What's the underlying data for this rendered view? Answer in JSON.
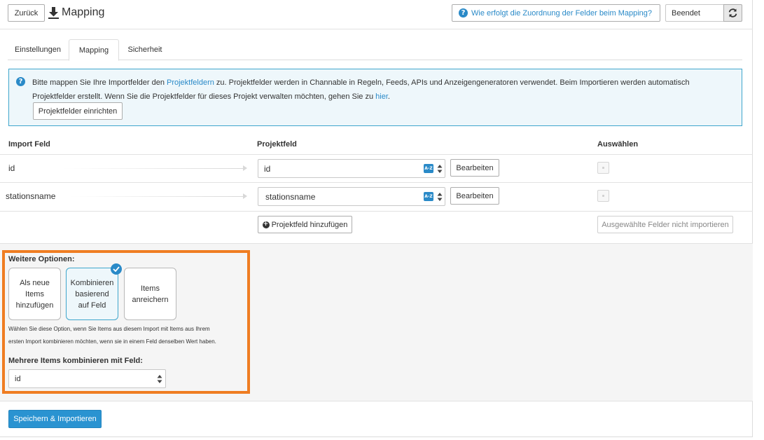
{
  "header": {
    "back_label": "Zurück",
    "title": "Mapping",
    "help_link": "Wie erfolgt die Zuordnung der Felder beim Mapping?",
    "status": "Beendet"
  },
  "tabs": [
    {
      "label": "Einstellungen"
    },
    {
      "label": "Mapping"
    },
    {
      "label": "Sicherheit"
    }
  ],
  "info": {
    "text_1": "Bitte mappen Sie Ihre Importfelder den ",
    "link_1": "Projektfeldern",
    "text_2": " zu. Projektfelder werden in Channable in Regeln, Feeds, APIs und Anzeigengeneratoren verwendet. Beim Importieren werden automatisch Projektfelder erstellt. Wenn Sie die Projektfelder für dieses Projekt verwalten möchten, gehen Sie zu ",
    "link_2": "hier",
    "text_3": ".",
    "setup_button": "Projektfelder einrichten"
  },
  "table": {
    "headers": {
      "import_field": "Import Feld",
      "project_field": "Projektfeld",
      "select": "Auswählen"
    },
    "rows": [
      {
        "import_field": "id",
        "project_field": "id",
        "edit_label": "Bearbeiten",
        "sort_badge": "A-Z"
      },
      {
        "import_field": "stationsname",
        "project_field": "stationsname",
        "edit_label": "Bearbeiten",
        "sort_badge": "A-Z"
      }
    ],
    "add_button": "Projektfeld hinzufügen",
    "skip_button": "Ausgewählte Felder nicht importieren"
  },
  "options": {
    "heading": "Weitere Optionen:",
    "cards": [
      {
        "label": "Als neue Items hinzufügen",
        "selected": false
      },
      {
        "label": "Kombinieren basierend auf Feld",
        "selected": true
      },
      {
        "label": "Items anreichern",
        "selected": false
      }
    ],
    "description_line_1": "Wählen Sie diese Option, wenn Sie Items aus diesem Import mit Items aus Ihrem",
    "description_line_2": "ersten Import kombinieren möchten, wenn sie in einem Feld denselben Wert haben.",
    "combine_label": "Mehrere Items kombinieren mit Feld:",
    "combine_value": "id"
  },
  "save_button": "Speichern & Importieren",
  "colors": {
    "accent": "#2a8ac8",
    "highlight_border": "#ef7d22",
    "info_bg": "#eef7fb"
  }
}
